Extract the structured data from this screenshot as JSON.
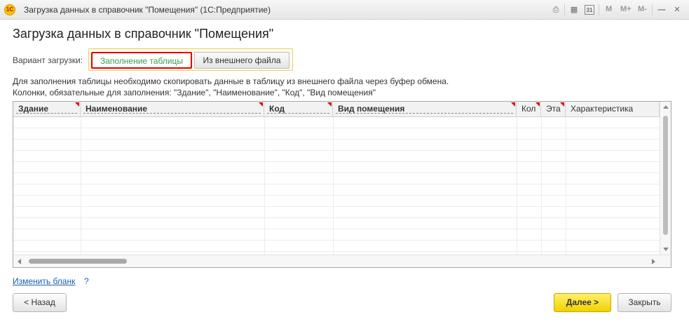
{
  "window": {
    "app_badge": "1С",
    "title": "Загрузка данных в справочник \"Помещения\"  (1С:Предприятие)",
    "toolbar": {
      "memory_m": "M",
      "memory_m_plus": "M+",
      "memory_m_minus": "M-",
      "calendar_day": "31"
    }
  },
  "page": {
    "title": "Загрузка данных в справочник \"Помещения\"",
    "variant_label": "Вариант загрузки:",
    "variants": [
      {
        "label": "Заполнение таблицы",
        "selected": true
      },
      {
        "label": "Из внешнего файла",
        "selected": false
      }
    ],
    "info_line1": "Для заполнения таблицы необходимо скопировать данные в таблицу из внешнего файла через буфер обмена.",
    "info_line2": "Колонки, обязательные для заполнения: \"Здание\", \"Наименование\", \"Код\", \"Вид помещения\""
  },
  "table": {
    "columns": [
      {
        "label": "Здание",
        "required": true
      },
      {
        "label": "Наименование",
        "required": true
      },
      {
        "label": "Код",
        "required": true
      },
      {
        "label": "Вид помещения",
        "required": true
      },
      {
        "label": "Кол",
        "required": true
      },
      {
        "label": "Эта",
        "required": true
      },
      {
        "label": "Характеристика",
        "required": false
      }
    ],
    "rows": []
  },
  "footer": {
    "change_form_link": "Изменить бланк",
    "help": "?",
    "back_button": "< Назад",
    "next_button": "Далее >",
    "close_button": "Закрыть"
  },
  "colors": {
    "accent_yellow": "#f1d200",
    "selected_text": "#3a9a4a",
    "highlight_red": "#e00000",
    "link_blue": "#1a5fb4"
  }
}
